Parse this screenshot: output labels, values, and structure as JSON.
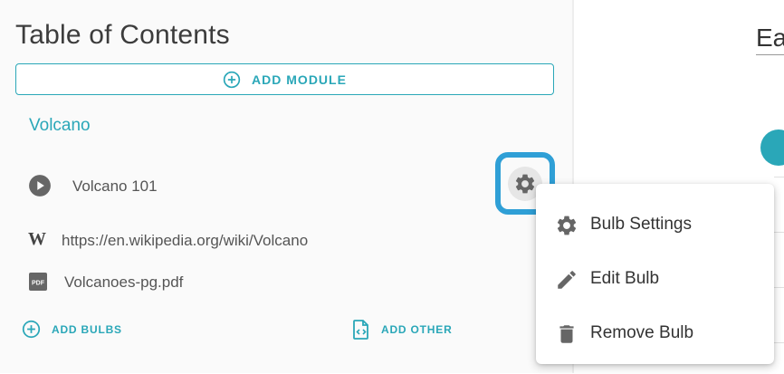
{
  "toc": {
    "title": "Table of Contents",
    "add_module_label": "ADD MODULE"
  },
  "module": {
    "title": "Volcano",
    "bulbs": [
      {
        "label": "Volcano 101",
        "icon": "play-circle-icon"
      },
      {
        "label": "https://en.wikipedia.org/wiki/Volcano",
        "icon": "wikipedia-icon"
      },
      {
        "label": "Volcanoes-pg.pdf",
        "icon": "pdf-icon"
      }
    ],
    "add_bulbs_label": "ADD BULBS",
    "add_other_label": "ADD OTHER"
  },
  "right_panel": {
    "title_fragment": "Ea"
  },
  "context_menu": {
    "items": [
      {
        "label": "Bulb Settings",
        "icon": "gear-icon"
      },
      {
        "label": "Edit Bulb",
        "icon": "pencil-icon"
      },
      {
        "label": "Remove Bulb",
        "icon": "trash-icon"
      }
    ]
  },
  "colors": {
    "accent": "#2aa7b8",
    "highlight_ring": "#2f9fd6",
    "icon_gray": "#666666"
  }
}
